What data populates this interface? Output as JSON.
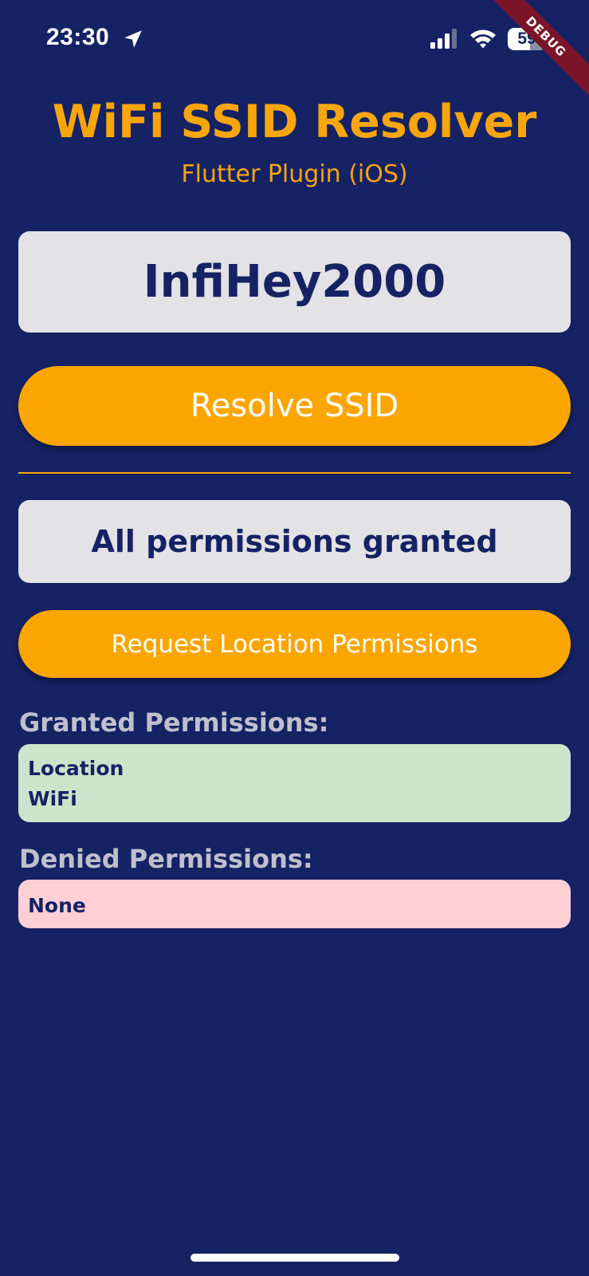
{
  "status_bar": {
    "time": "23:30",
    "battery_level": "59",
    "icons": [
      "location-arrow-icon",
      "cellular-signal-icon",
      "wifi-icon",
      "battery-icon"
    ]
  },
  "debug_banner": "DEBUG",
  "header": {
    "title": "WiFi SSID Resolver",
    "subtitle": "Flutter Plugin (iOS)"
  },
  "ssid": {
    "value": "InfiHey2000"
  },
  "buttons": {
    "resolve_label": "Resolve SSID",
    "request_label": "Request Location Permissions"
  },
  "permission_status": "All permissions granted",
  "granted": {
    "heading": "Granted Permissions:",
    "items": [
      "Location",
      "WiFi"
    ]
  },
  "denied": {
    "heading": "Denied Permissions:",
    "items": [
      "None"
    ]
  },
  "colors": {
    "background": "#152264",
    "accent": "#f8a50e",
    "button": "#fba600",
    "card": "#e3e2e4",
    "granted_bg": "#c9e6ca",
    "denied_bg": "#fecfd4"
  }
}
